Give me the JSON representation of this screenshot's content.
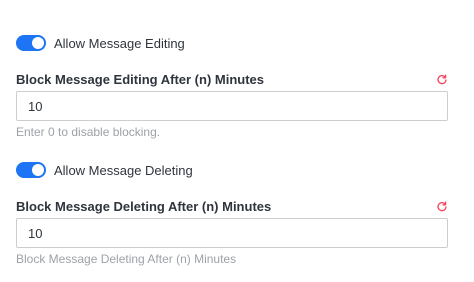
{
  "settings": {
    "editing": {
      "toggle_label": "Allow Message Editing",
      "toggle_on": true,
      "field_label": "Block Message Editing After (n) Minutes",
      "value": "10",
      "hint": "Enter 0 to disable blocking.",
      "reset_icon": "reset-icon"
    },
    "deleting": {
      "toggle_label": "Allow Message Deleting",
      "toggle_on": true,
      "field_label": "Block Message Deleting After (n) Minutes",
      "value": "10",
      "hint": "Block Message Deleting After (n) Minutes",
      "reset_icon": "reset-icon"
    }
  },
  "colors": {
    "toggle_on": "#1d74f5",
    "reset_icon": "#f5455c",
    "label": "#2f343d",
    "hint": "#9ea2a8",
    "input_border": "#cbced1"
  }
}
